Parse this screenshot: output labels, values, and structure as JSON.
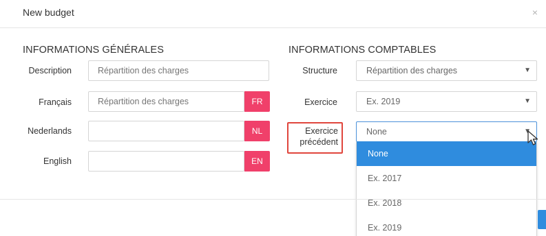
{
  "modal": {
    "title": "New budget",
    "close_glyph": "×"
  },
  "general": {
    "title": "INFORMATIONS GÉNÉRALES",
    "description": {
      "label": "Description",
      "placeholder": "Répartition des charges"
    },
    "francais": {
      "label": "Français",
      "placeholder": "Répartition des charges",
      "lang": "FR"
    },
    "nederlands": {
      "label": "Nederlands",
      "placeholder": "",
      "lang": "NL"
    },
    "english": {
      "label": "English",
      "placeholder": "",
      "lang": "EN"
    }
  },
  "accounting": {
    "title": "INFORMATIONS COMPTABLES",
    "structure": {
      "label": "Structure",
      "value": "Répartition des charges"
    },
    "exercice": {
      "label": "Exercice",
      "value": "Ex. 2019"
    },
    "exercice_precedent": {
      "label_line1": "Exercice",
      "label_line2": "précédent",
      "value": "None"
    }
  },
  "dropdown": {
    "options": [
      "None",
      "Ex. 2017",
      "Ex. 2018",
      "Ex. 2019"
    ],
    "selected_index": 0
  },
  "icons": {
    "caret": "▼",
    "close": "close-icon",
    "cursor": "cursor-arrow-icon"
  },
  "colors": {
    "lang_badge": "#f0406a",
    "selected_option": "#2f8cde",
    "highlight_box": "#e0453c"
  }
}
